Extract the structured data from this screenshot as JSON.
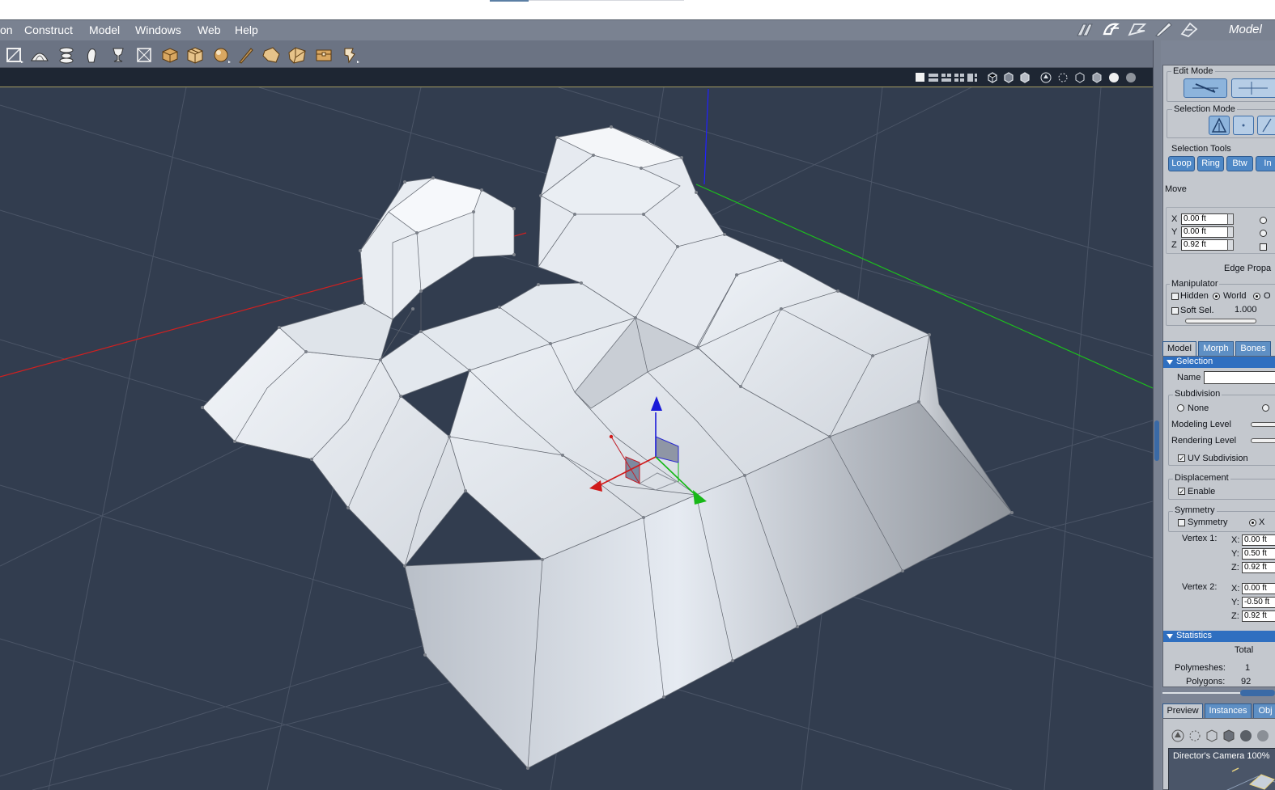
{
  "menu": {
    "items": [
      "on",
      "Construct",
      "Model",
      "Windows",
      "Web",
      "Help"
    ],
    "room": "Model"
  },
  "icons": {
    "rooms": [
      "pose-room-icon",
      "face-room-icon",
      "hair-room-icon",
      "cloth-room-icon",
      "material-room-icon"
    ],
    "tools": [
      "frame-tool-icon",
      "dome-tool-icon",
      "lathe-tool-icon",
      "extrude-tool-icon",
      "goblet-tool-icon",
      "box-frame-tool-icon",
      "cube-tool-icon",
      "package-tool-icon",
      "sphere-tool-icon",
      "pencil-tool-icon",
      "hand-tool-icon",
      "folded-box-tool-icon",
      "chest-tool-icon",
      "torn-paper-tool-icon"
    ]
  },
  "viewport": {
    "background": "#323d4f",
    "axis_x_color": "#e02020",
    "axis_y_color": "#20c020",
    "axis_z_color": "#1a1aff"
  },
  "panel": {
    "edit_mode": {
      "label": "Edit Mode"
    },
    "selection_mode": {
      "label": "Selection Mode"
    },
    "selection_tools": {
      "label": "Selection Tools",
      "buttons": [
        "Loop",
        "Ring",
        "Btw",
        "In"
      ]
    },
    "move": {
      "label": "Move",
      "x_label": "X",
      "x_value": "0.00 ft",
      "y_label": "Y",
      "y_value": "0.00 ft",
      "z_label": "Z",
      "z_value": "0.92 ft",
      "edge_props": "Edge Propa"
    },
    "manipulator": {
      "label": "Manipulator",
      "hidden": "Hidden",
      "world": "World",
      "other": "O",
      "soft_sel": "Soft Sel.",
      "soft_value": "1.000"
    },
    "tabs": [
      "Model",
      "Morph",
      "Bones"
    ],
    "selection": {
      "header": "Selection",
      "name_label": "Name",
      "name_value": "",
      "subdivision": {
        "label": "Subdivision",
        "none": "None",
        "modeling_level": "Modeling Level",
        "rendering_level": "Rendering Level",
        "uv_subdivision": "UV Subdivision"
      },
      "displacement": {
        "label": "Displacement",
        "enable": "Enable"
      },
      "symmetry": {
        "label": "Symmetry",
        "checkbox": "Symmetry",
        "axis": "X",
        "vertex1_label": "Vertex 1:",
        "v1x_label": "X:",
        "v1x": "0.00 ft",
        "v1y_label": "Y:",
        "v1y": "0.50 ft",
        "v1z_label": "Z:",
        "v1z": "0.92 ft",
        "vertex2_label": "Vertex 2:",
        "v2x_label": "X:",
        "v2x": "0.00 ft",
        "v2y_label": "Y:",
        "v2y": "-0.50 ft",
        "v2z_label": "Z:",
        "v2z": "0.92 ft"
      }
    },
    "statistics": {
      "header": "Statistics",
      "total": "Total",
      "polymeshes_label": "Polymeshes:",
      "polymeshes": "1",
      "polygons_label": "Polygons:",
      "polygons": "92"
    },
    "preview_tabs": [
      "Preview",
      "Instances",
      "Obj"
    ],
    "preview": {
      "camera": "Director's Camera 100%"
    }
  }
}
